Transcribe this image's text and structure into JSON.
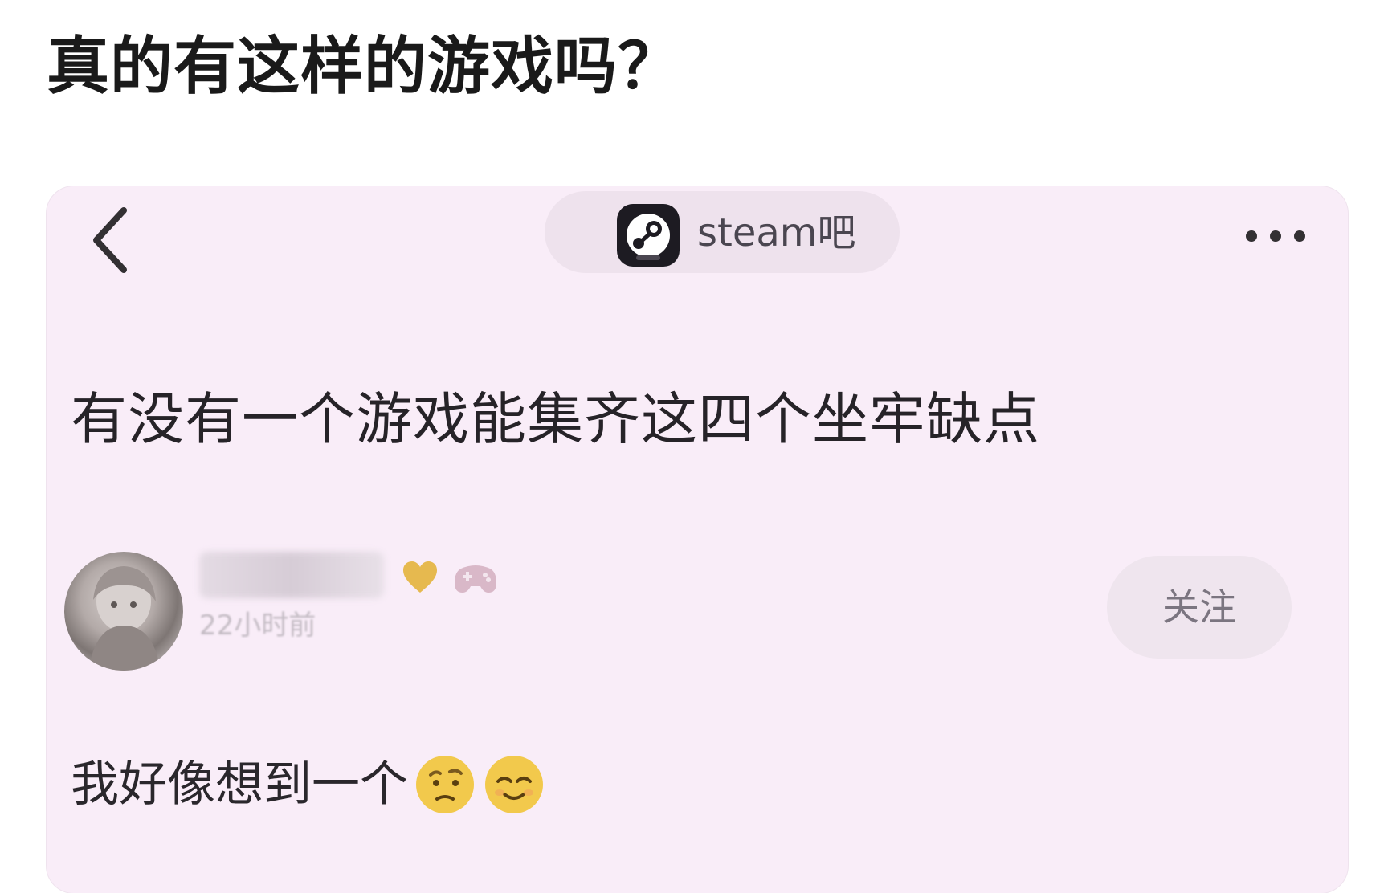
{
  "outer_title": "真的有这样的游戏吗？",
  "header": {
    "forum_name": "steam吧"
  },
  "post": {
    "title": "有没有一个游戏能集齐这四个坐牢缺点",
    "time": "22小时前",
    "follow_label": "关注",
    "body": "我好像想到一个"
  },
  "icons": {
    "back": "chevron-left-icon",
    "forum": "steam-logo-icon",
    "more": "more-dots-icon",
    "emoji_1": "thinking-face-emoji",
    "emoji_2": "smiling-face-emoji"
  },
  "colors": {
    "card_background": "#f9edf8",
    "chip_background": "#eee2ed",
    "badge_gold": "#e6b94f"
  }
}
